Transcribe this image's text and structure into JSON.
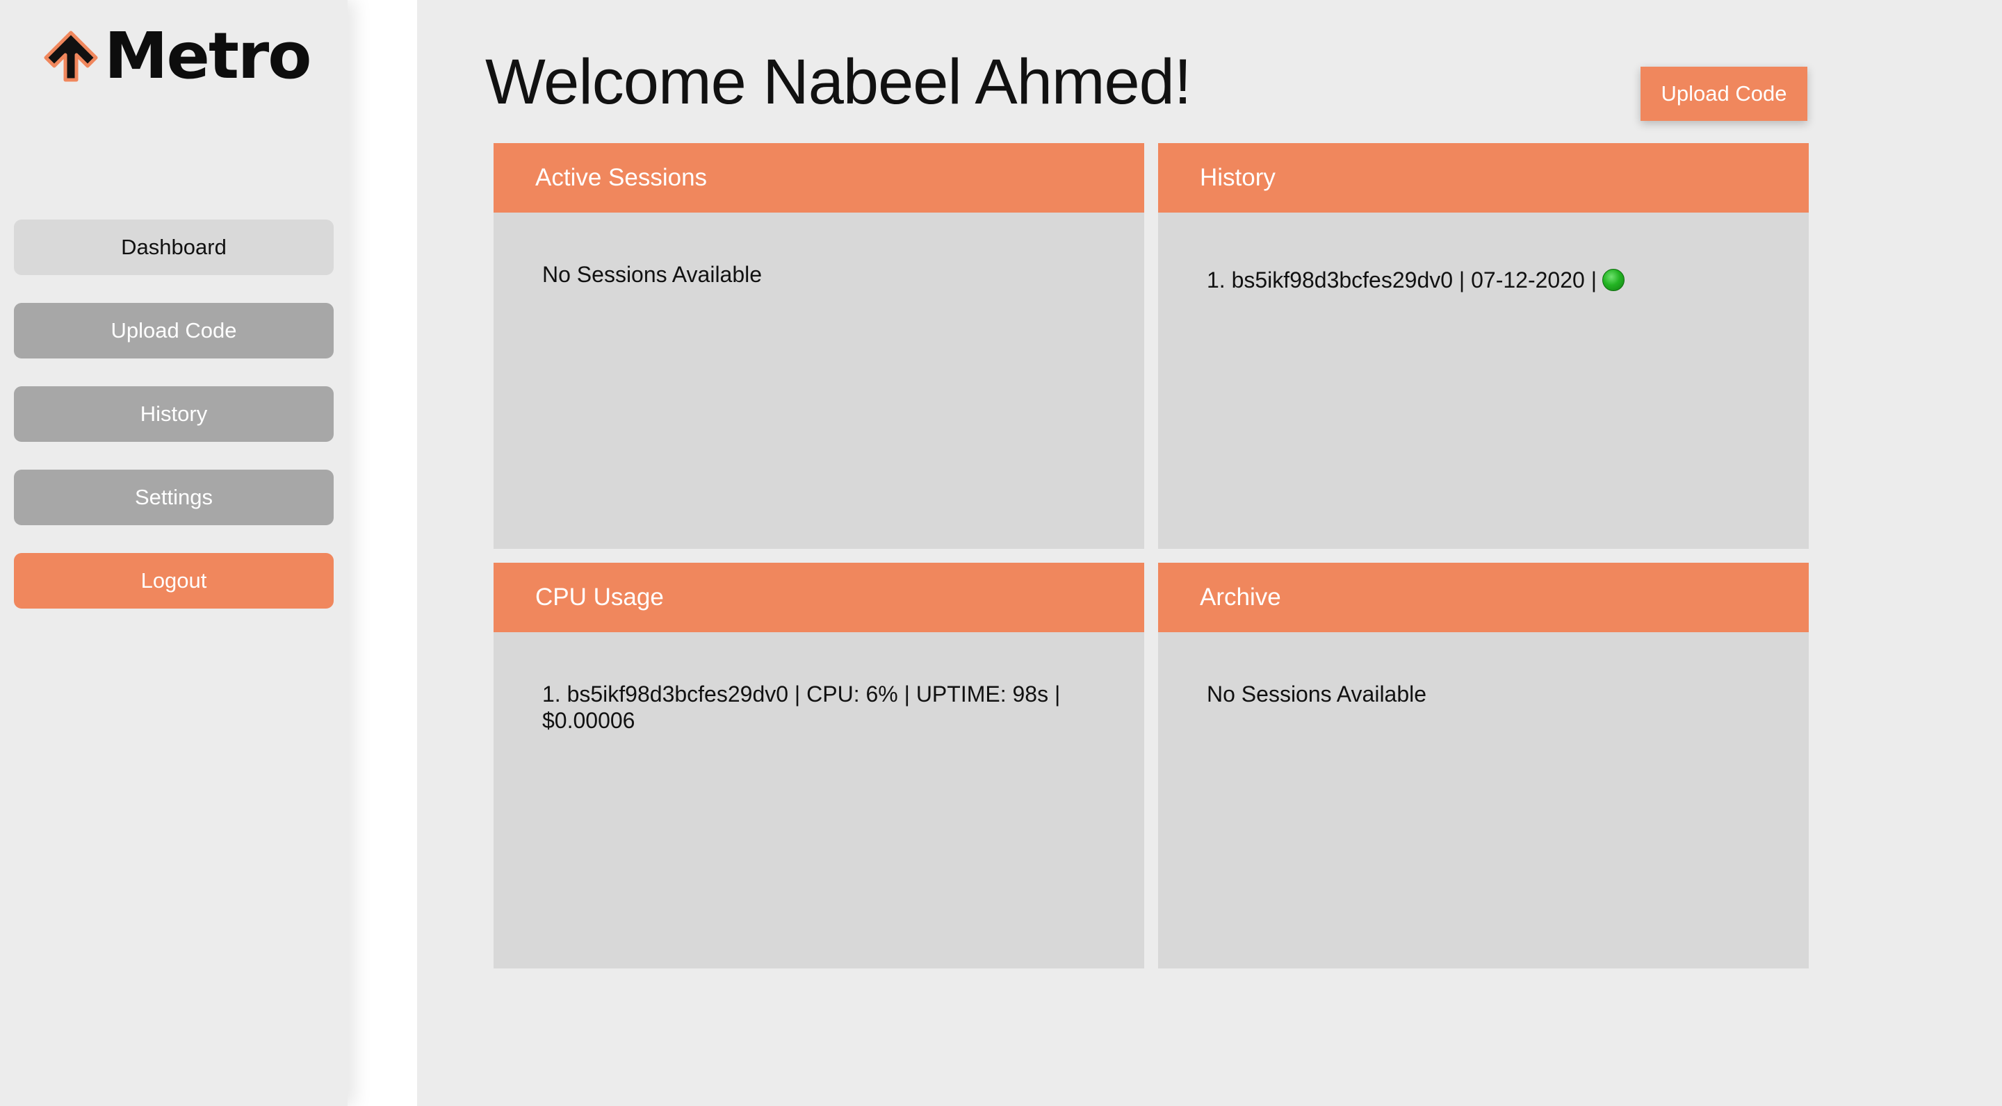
{
  "brand": {
    "name": "Metro",
    "logo_icon": "up-arrow-icon"
  },
  "sidebar": {
    "items": [
      {
        "label": "Dashboard",
        "state": "active"
      },
      {
        "label": "Upload Code",
        "state": "normal"
      },
      {
        "label": "History",
        "state": "normal"
      },
      {
        "label": "Settings",
        "state": "normal"
      },
      {
        "label": "Logout",
        "state": "danger"
      }
    ]
  },
  "header": {
    "welcome": "Welcome Nabeel Ahmed!",
    "upload_button": "Upload Code"
  },
  "panels": {
    "active_sessions": {
      "title": "Active Sessions",
      "empty_text": "No Sessions Available"
    },
    "history": {
      "title": "History",
      "items": [
        {
          "number": "1.",
          "text": "bs5ikf98d3bcfes29dv0 | 07-12-2020 |",
          "status": "success",
          "status_color": "#23b423"
        }
      ]
    },
    "cpu_usage": {
      "title": "CPU Usage",
      "items": [
        {
          "number": "1.",
          "text": "bs5ikf98d3bcfes29dv0 | CPU: 6% | UPTIME: 98s | $0.00006"
        }
      ]
    },
    "archive": {
      "title": "Archive",
      "empty_text": "No Sessions Available"
    }
  },
  "colors": {
    "accent": "#f0875d",
    "sidebar_bg": "#ececec",
    "panel_bg": "#d8d8d8",
    "nav_inactive": "#a7a7a7",
    "nav_active": "#d9d9d9"
  }
}
